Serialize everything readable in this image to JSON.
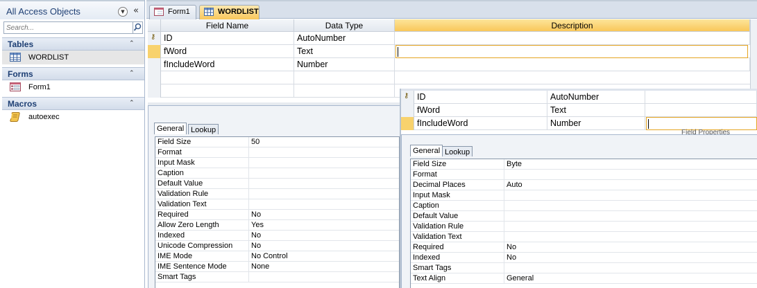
{
  "nav": {
    "title": "All Access Objects",
    "search_placeholder": "Search...",
    "groups": [
      {
        "label": "Tables",
        "items": [
          {
            "label": "WORDLIST",
            "icon": "table-icon"
          }
        ]
      },
      {
        "label": "Forms",
        "items": [
          {
            "label": "Form1",
            "icon": "form-icon"
          }
        ]
      },
      {
        "label": "Macros",
        "items": [
          {
            "label": "autoexec",
            "icon": "macro-icon"
          }
        ]
      }
    ]
  },
  "tabs": [
    {
      "label": "Form1",
      "icon": "form-icon"
    },
    {
      "label": "WORDLIST",
      "icon": "table-icon"
    }
  ],
  "grid": {
    "headers": [
      "Field Name",
      "Data Type",
      "Description"
    ],
    "rows": [
      {
        "name": "ID",
        "type": "AutoNumber",
        "key": true
      },
      {
        "name": "fWord",
        "type": "Text",
        "key": false
      },
      {
        "name": "fIncludeWord",
        "type": "Number",
        "key": false
      }
    ]
  },
  "grid2": {
    "rows": [
      {
        "name": "ID",
        "type": "AutoNumber"
      },
      {
        "name": "fWord",
        "type": "Text"
      },
      {
        "name": "fIncludeWord",
        "type": "Number"
      }
    ],
    "field_properties_label": "Field Properties"
  },
  "props1": {
    "tabs": [
      "General",
      "Lookup"
    ],
    "rows": [
      {
        "k": "Field Size",
        "v": "50"
      },
      {
        "k": "Format",
        "v": ""
      },
      {
        "k": "Input Mask",
        "v": ""
      },
      {
        "k": "Caption",
        "v": ""
      },
      {
        "k": "Default Value",
        "v": ""
      },
      {
        "k": "Validation Rule",
        "v": ""
      },
      {
        "k": "Validation Text",
        "v": ""
      },
      {
        "k": "Required",
        "v": "No"
      },
      {
        "k": "Allow Zero Length",
        "v": "Yes"
      },
      {
        "k": "Indexed",
        "v": "No"
      },
      {
        "k": "Unicode Compression",
        "v": "No"
      },
      {
        "k": "IME Mode",
        "v": "No Control"
      },
      {
        "k": "IME Sentence Mode",
        "v": "None"
      },
      {
        "k": "Smart Tags",
        "v": ""
      }
    ]
  },
  "props2": {
    "tabs": [
      "General",
      "Lookup"
    ],
    "rows": [
      {
        "k": "Field Size",
        "v": "Byte"
      },
      {
        "k": "Format",
        "v": ""
      },
      {
        "k": "Decimal Places",
        "v": "Auto"
      },
      {
        "k": "Input Mask",
        "v": ""
      },
      {
        "k": "Caption",
        "v": ""
      },
      {
        "k": "Default Value",
        "v": ""
      },
      {
        "k": "Validation Rule",
        "v": ""
      },
      {
        "k": "Validation Text",
        "v": ""
      },
      {
        "k": "Required",
        "v": "No"
      },
      {
        "k": "Indexed",
        "v": "No"
      },
      {
        "k": "Smart Tags",
        "v": ""
      },
      {
        "k": "Text Align",
        "v": "General"
      }
    ]
  },
  "colors": {
    "accent": "#f9c75a",
    "nav_text": "#1e3f74",
    "focus_border": "#e5a521"
  }
}
